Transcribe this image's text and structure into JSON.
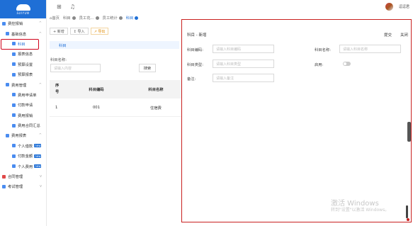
{
  "sidebar": {
    "logo_text": "SUIYUN",
    "items": [
      {
        "label": "费控报销",
        "level": 1,
        "expanded": true
      },
      {
        "label": "基础信息",
        "level": 2,
        "expanded": true
      },
      {
        "label": "科目",
        "level": 3,
        "active": true
      },
      {
        "label": "报表信息",
        "level": 3
      },
      {
        "label": "预算设置",
        "level": 3
      },
      {
        "label": "预算报表",
        "level": 3
      },
      {
        "label": "费用管理",
        "level": 2,
        "expanded": true
      },
      {
        "label": "费用申请单",
        "level": 3
      },
      {
        "label": "付款申请",
        "level": 3
      },
      {
        "label": "费用报销",
        "level": 3
      },
      {
        "label": "费用合同汇总",
        "level": 3
      },
      {
        "label": "费用报表",
        "level": 2,
        "expanded": true
      },
      {
        "label": "个人借款",
        "level": 3,
        "badge": "new"
      },
      {
        "label": "付款金额",
        "level": 3,
        "badge": "new"
      },
      {
        "label": "个人费用",
        "level": 3,
        "badge": "new"
      },
      {
        "label": "合同管理",
        "level": 1
      },
      {
        "label": "考试管理",
        "level": 1
      }
    ]
  },
  "topbar": {
    "user_name": "逗逗君"
  },
  "tabs": [
    {
      "label": "首页"
    },
    {
      "label": "科目"
    },
    {
      "label": "员工花..."
    },
    {
      "label": "员工统计"
    },
    {
      "label": "科目",
      "active": true
    }
  ],
  "toolbar": {
    "add": "+ 新增",
    "import": "↥ 导入",
    "export": "↗ 导出"
  },
  "subtab": "科目",
  "filter": {
    "label": "科目名称:",
    "placeholder": "请输入内容",
    "search_button": "搜索"
  },
  "table": {
    "headers": [
      "序号",
      "科目编码",
      "科目名称"
    ],
    "rows": [
      [
        "1",
        "001",
        "住宿费"
      ]
    ]
  },
  "modal": {
    "title": "科目 - 新增",
    "submit": "提交",
    "close": "关闭",
    "code_label": "科目编码:",
    "code_placeholder": "请输入科目编码",
    "name_label": "科目名称:",
    "name_placeholder": "请输入科目名称",
    "type_label": "科目类型:",
    "type_placeholder": "请输入科目类型",
    "enabled_label": "启用:",
    "enabled": false,
    "remark_label": "备注:",
    "remark_placeholder": "请输入备注"
  },
  "watermark": {
    "line1": "激活 Windows",
    "line2": "转到\"设置\"以激活 Windows。"
  }
}
